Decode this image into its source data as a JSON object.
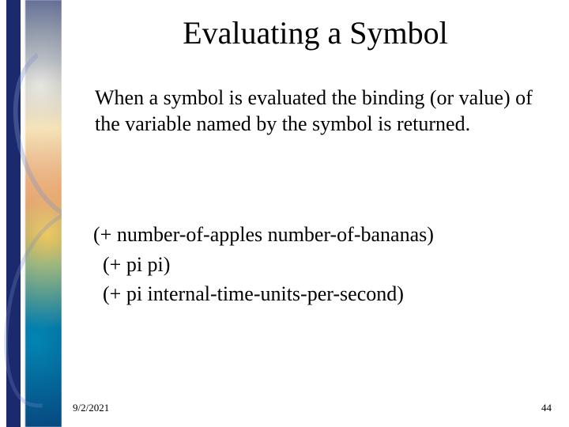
{
  "title": "Evaluating a Symbol",
  "paragraph": "When a symbol is evaluated the binding (or value) of the variable named by the symbol is returned.",
  "code": {
    "line1": "(+ number-of-apples number-of-bananas)",
    "line2": "(+ pi pi)",
    "line3": "(+ pi internal-time-units-per-second)"
  },
  "footer": {
    "date": "9/2/2021",
    "page": "44"
  }
}
